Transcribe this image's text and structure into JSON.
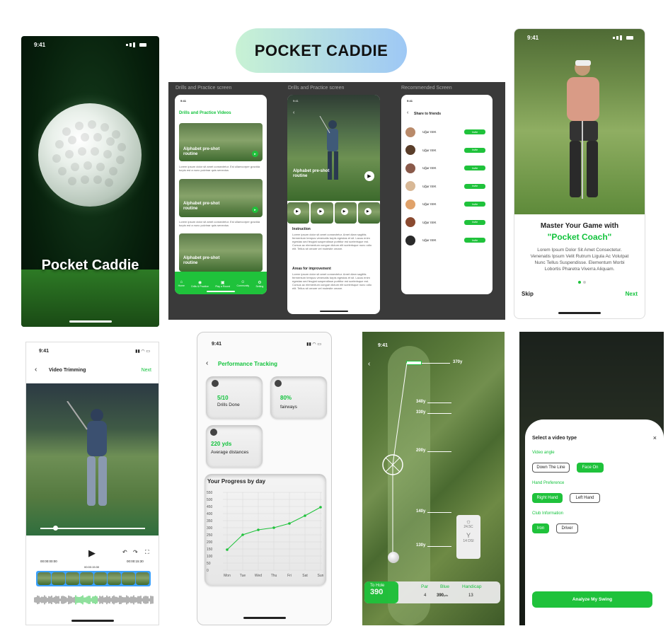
{
  "header": {
    "title": "POCKET CADDIE"
  },
  "time": "9:41",
  "splash": {
    "brand": "Pocket Caddie"
  },
  "panel": {
    "labels": [
      "Drills and Practice screen",
      "Drills and Practice screen",
      "Recommended Screen"
    ],
    "drills": {
      "title": "Drills and Practice Videos",
      "videos": [
        {
          "title": "Alphabet pre-shot routine",
          "desc": "Lorem ipsum dolor sit amet consectetur. Est ullamcorper gravida turpis est a nunc pulvinar quis senectus"
        },
        {
          "title": "Alphabet pre-shot routine",
          "desc": "Lorem ipsum dolor sit amet consectetur. Est ullamcorper gravida turpis est a nunc pulvinar quis senectus"
        },
        {
          "title": "Alphabet pre-shot routine",
          "desc": ""
        }
      ],
      "nav": [
        "Home",
        "Drills & Practice",
        "Play a Round",
        "Community",
        "Setting"
      ]
    },
    "detail": {
      "video_title": "Alphabet pre-shot routine",
      "instruction_h": "Instruction",
      "instruction": "Lorem ipsum dolor sit amet consectetur. Amet diam sagittis fermentum tempus venenatis turpis egestas et sit. Lacus enim egestas sed feugiat suspendisse porttitor est scelerisque est. Cursus ac elementum congue dictum elit scelerisque nunc odio elit. Tellus sit ornare vel molestie ornare.",
      "areas_h": "Areas for improvement",
      "areas": "Lorem ipsum dolor sit amet consectetur. Amet diam sagittis fermentum tempus venenatis turpis egestas et sit. Lacus enim egestas sed feugiat suspendisse porttitor est scelerisque est. Cursus ac elementum congue dictum elit scelerisque nunc odio elit. Tellus sit ornare vel molestie ornare."
    },
    "share": {
      "title": "Share to friends",
      "friends": [
        {
          "name": "Uğur ISIK",
          "btn": "Invite"
        },
        {
          "name": "Uğur ISIK",
          "btn": "Invite"
        },
        {
          "name": "Uğur ISIK",
          "btn": "Invite"
        },
        {
          "name": "Uğur ISIK",
          "btn": "Invite"
        },
        {
          "name": "Uğur ISIK",
          "btn": "Invite"
        },
        {
          "name": "Uğur ISIK",
          "btn": "Invite"
        },
        {
          "name": "Uğur ISIK",
          "btn": "Invite"
        }
      ]
    }
  },
  "onboard": {
    "title1": "Master Your Game with",
    "title2": "\"Pocket Coach\"",
    "body": "Lorem Ipsum Dolor Sit Amet Consectetur. Venenatis Ipsum Velit Rutrum Ligula Ac Volutpat Nunc Tellus Suspendisse. Elementum Morbi Lobortis Pharetra Viverra Aliquam.",
    "skip": "Skip",
    "next": "Next"
  },
  "trim": {
    "title": "Video Trimming",
    "next": "Next",
    "t_start": "00:00:00:00",
    "t_mid": "00:00:15:30",
    "t_end": "00:00:15:30"
  },
  "perf": {
    "title": "Performance Tracking",
    "stats": [
      {
        "value": "5/10",
        "label": "Drills Done"
      },
      {
        "value": "80%",
        "label": "fairways"
      },
      {
        "value": "220 yds",
        "label": "Average distances"
      }
    ],
    "chart_title": "Your Progress by day"
  },
  "chart_data": {
    "type": "line",
    "title": "Your Progress by day",
    "categories": [
      "Mon",
      "Tue",
      "Wed",
      "Thu",
      "Fri",
      "Sat",
      "Sun"
    ],
    "y_ticks": [
      "0",
      "50",
      "100",
      "150",
      "200",
      "250",
      "300",
      "350",
      "400",
      "450",
      "500",
      "550"
    ],
    "ylim": [
      0,
      550
    ],
    "series": [
      {
        "values": [
          145,
          250,
          285,
          300,
          330,
          385,
          445
        ]
      }
    ],
    "grid": true,
    "color": "#1fc23b"
  },
  "course": {
    "top": "370y",
    "marks": [
      "340y",
      "330y",
      "200y",
      "140y",
      "130y"
    ],
    "weather": [
      "24.5C",
      "14 DSI"
    ],
    "to_hole_label": "To Hole",
    "to_hole": "390",
    "cols": [
      "Par",
      "Blue",
      "Handicap"
    ],
    "vals": [
      "4",
      "390",
      "13"
    ],
    "unit": "yds"
  },
  "vtype": {
    "title": "Select a video type",
    "close": "×",
    "angle_h": "Video angle",
    "angle": [
      "Down The Line",
      "Face On"
    ],
    "hand_h": "Hand Preference",
    "hand": [
      "Right Hand",
      "Left Hand"
    ],
    "club_h": "Club Information",
    "club": [
      "Iron",
      "Driver"
    ],
    "cta": "Analyze My Swing"
  }
}
